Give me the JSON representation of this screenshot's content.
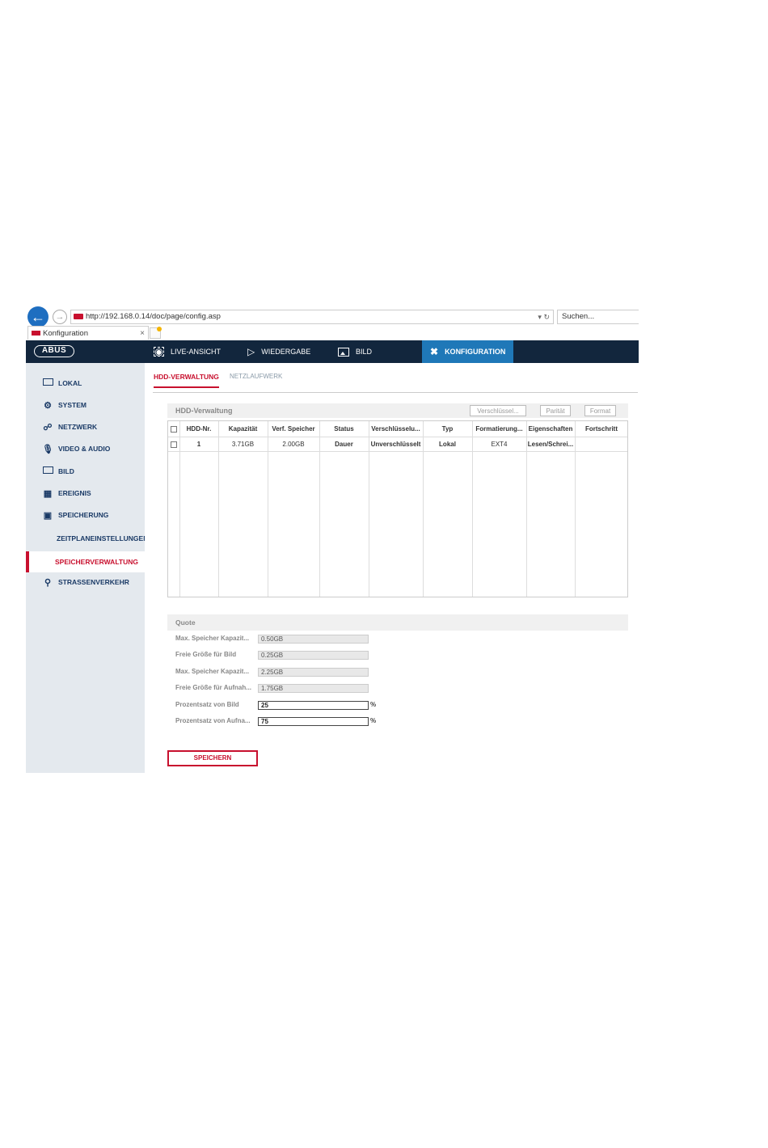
{
  "browser": {
    "url": "http://192.168.0.14/doc/page/config.asp",
    "search_placeholder": "Suchen...",
    "tab_title": "Konfiguration",
    "tab_close": "×"
  },
  "topnav": {
    "logo": "ABUS",
    "items": [
      {
        "label": "LIVE-ANSICHT",
        "icon": "eye-icon"
      },
      {
        "label": "WIEDERGABE",
        "icon": "play-icon"
      },
      {
        "label": "BILD",
        "icon": "image-icon"
      },
      {
        "label": "KONFIGURATION",
        "icon": "tools-icon",
        "active": true
      }
    ]
  },
  "sidebar": {
    "items": [
      {
        "label": "LOKAL",
        "icon": "monitor-icon"
      },
      {
        "label": "SYSTEM",
        "icon": "gear-icon"
      },
      {
        "label": "NETZWERK",
        "icon": "network-icon"
      },
      {
        "label": "VIDEO & AUDIO",
        "icon": "microphone-icon"
      },
      {
        "label": "BILD",
        "icon": "image-icon"
      },
      {
        "label": "EREIGNIS",
        "icon": "calendar-icon"
      },
      {
        "label": "SPEICHERUNG",
        "icon": "save-icon"
      },
      {
        "label": "ZEITPLANEINSTELLUNGEN",
        "sub": true
      },
      {
        "label": "SPEICHERVERWALTUNG",
        "sub": true,
        "active": true
      },
      {
        "label": "STRAßENVERKEHR",
        "icon": "traffic-search-icon"
      }
    ]
  },
  "content_tabs": {
    "active": "HDD-VERWALTUNG",
    "inactive": "NETZLAUFWERK"
  },
  "hdd_panel": {
    "title": "HDD-Verwaltung",
    "buttons": [
      "Verschlüssel...",
      "Parität",
      "Format"
    ]
  },
  "hdd_table": {
    "headers": [
      "HDD-Nr.",
      "Kapazität",
      "Verf. Speicher",
      "Status",
      "Verschlüsselu...",
      "Typ",
      "Formatierung...",
      "Eigenschaften",
      "Fortschritt"
    ],
    "rows": [
      [
        "1",
        "3.71GB",
        "2.00GB",
        "Dauer",
        "Unverschlüsselt",
        "Lokal",
        "EXT4",
        "Lesen/Schrei...",
        ""
      ]
    ]
  },
  "quota": {
    "title": "Quote",
    "fields": [
      {
        "label": "Max. Speicher Kapazit...",
        "value": "0.50GB",
        "readonly": true
      },
      {
        "label": "Freie Größe für Bild",
        "value": "0.25GB",
        "readonly": true
      },
      {
        "label": "Max. Speicher Kapazit...",
        "value": "2.25GB",
        "readonly": true
      },
      {
        "label": "Freie Größe für Aufnah...",
        "value": "1.75GB",
        "readonly": true
      },
      {
        "label": "Prozentsatz von Bild",
        "value": "25",
        "readonly": false,
        "unit": "%"
      },
      {
        "label": "Prozentsatz von Aufna...",
        "value": "75",
        "readonly": false,
        "unit": "%"
      }
    ]
  },
  "save_label": "SPEICHERN",
  "colors": {
    "nav_bg": "#12263d",
    "nav_active": "#1f78b8",
    "accent_red": "#c8102e",
    "sidebar_bg": "#e4e9ee",
    "sidebar_text": "#1a3a66"
  }
}
